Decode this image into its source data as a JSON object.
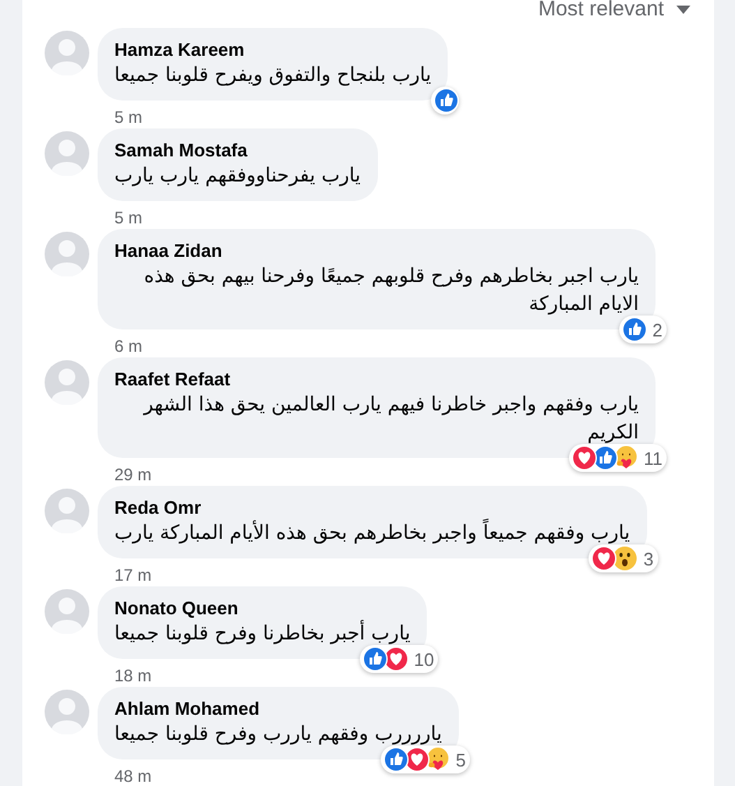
{
  "sort_menu": {
    "label": "Most relevant"
  },
  "comments": [
    {
      "author": "Hamza Kareem",
      "text": "يارب بلنجاح والتفوق ويفرح قلوبنا جميعا",
      "time": "5 m",
      "reactions": [
        {
          "kind": "like"
        }
      ]
    },
    {
      "author": "Samah Mostafa",
      "text": "يارب يفرحناووفقهم يارب يارب",
      "time": "5 m"
    },
    {
      "author": "Hanaa Zidan",
      "text": "يارب اجبر بخاطرهم وفرح قلوبهم جميعًا وفرحنا بيهم بحق هذه الايام المباركة",
      "time": "6 m",
      "reactions": [
        {
          "kind": "like"
        }
      ],
      "count": "2"
    },
    {
      "author": "Raafet Refaat",
      "text": "يارب وفقهم واجبر خاطرنا فيهم يارب العالمين يحق هذا الشهر الكريم",
      "time": "29 m",
      "reactions": [
        {
          "kind": "love"
        },
        {
          "kind": "like"
        },
        {
          "kind": "care"
        }
      ],
      "count": "11"
    },
    {
      "author": "Reda Omr",
      "text": "يارب وفقهم جميعاً واجبر بخاطرهم بحق هذه الأيام المباركة يارب",
      "time": "17 m",
      "reactions": [
        {
          "kind": "love"
        },
        {
          "kind": "wow"
        }
      ],
      "count": "3"
    },
    {
      "author": "Nonato Queen",
      "text": "يارب أجبر بخاطرنا وفرح قلوبنا جميعا",
      "time": "18 m",
      "reactions": [
        {
          "kind": "like"
        },
        {
          "kind": "love"
        }
      ],
      "count": "10"
    },
    {
      "author": "Ahlam Mohamed",
      "text": "ياررررب وفقهم ياررب وفرح قلوبنا جميعا",
      "time": "48 m",
      "reactions": [
        {
          "kind": "like"
        },
        {
          "kind": "love"
        },
        {
          "kind": "care"
        }
      ],
      "count": "5"
    }
  ]
}
